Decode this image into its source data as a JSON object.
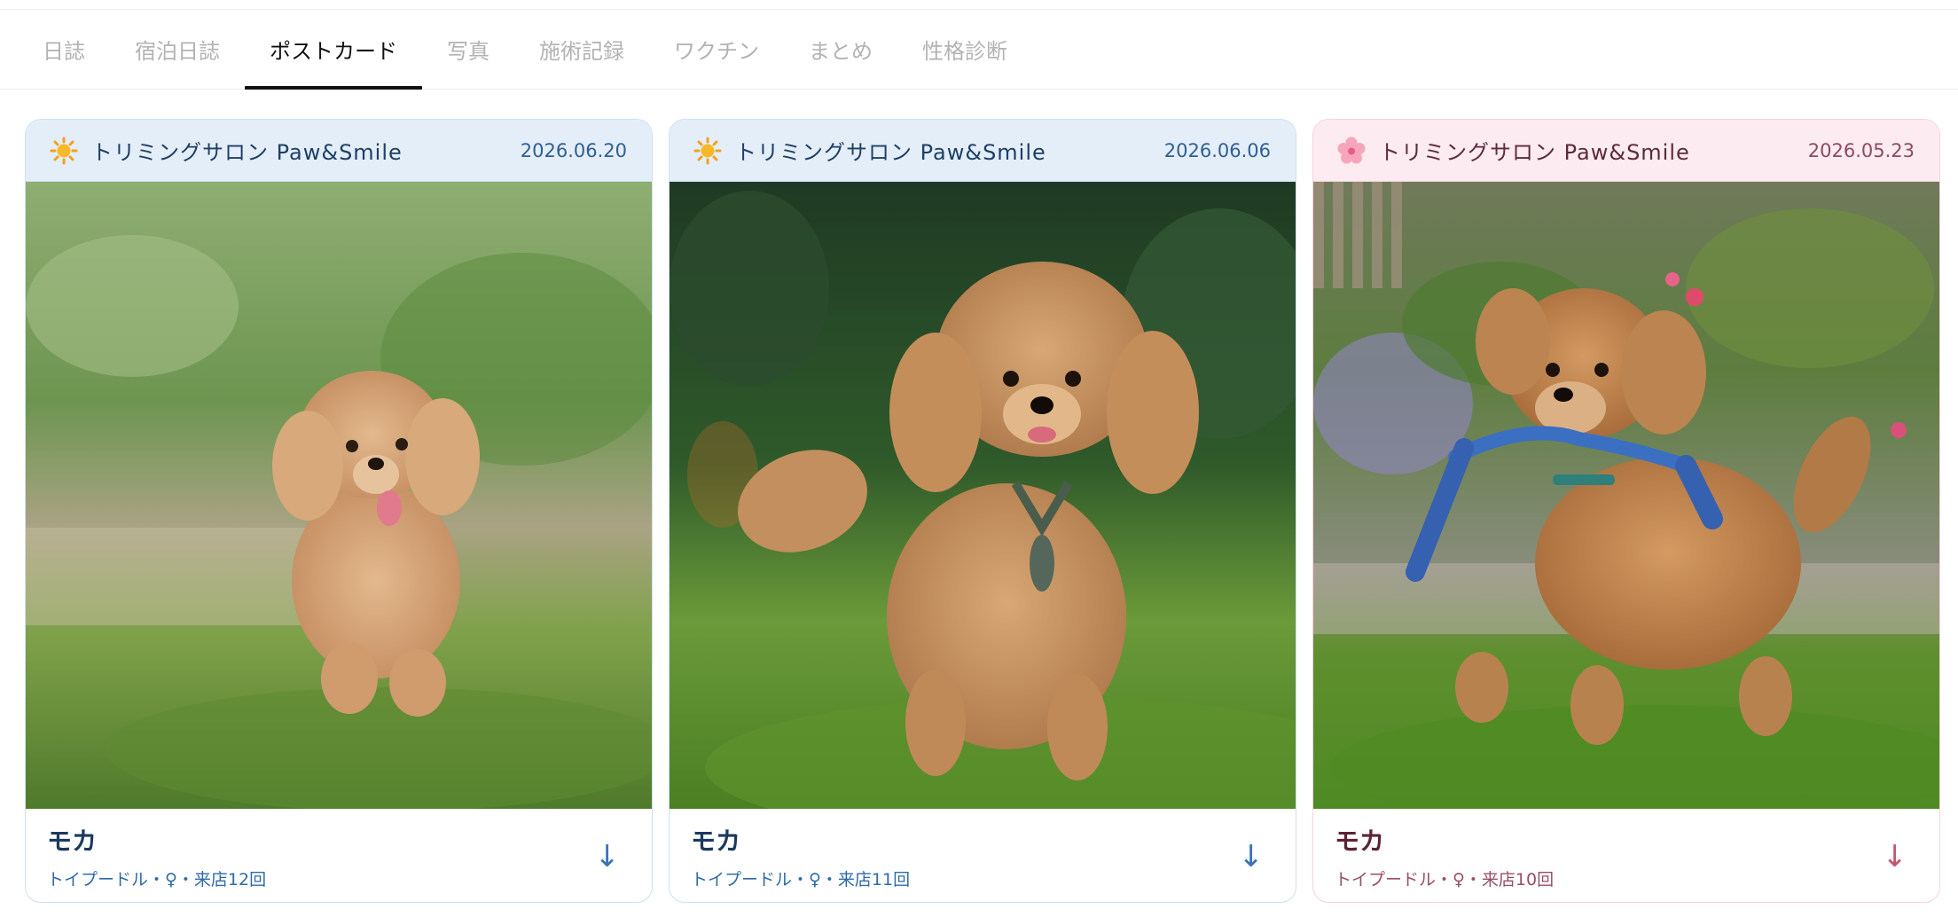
{
  "tabs": [
    {
      "label": "日誌",
      "active": false
    },
    {
      "label": "宿泊日誌",
      "active": false
    },
    {
      "label": "ポストカード",
      "active": true
    },
    {
      "label": "写真",
      "active": false
    },
    {
      "label": "施術記録",
      "active": false
    },
    {
      "label": "ワクチン",
      "active": false
    },
    {
      "label": "まとめ",
      "active": false
    },
    {
      "label": "性格診断",
      "active": false
    }
  ],
  "postcards": [
    {
      "theme": "blue",
      "icon": "sun-icon",
      "salon": "トリミングサロン Paw&Smile",
      "date": "2026.06.20",
      "pet_name": "モカ",
      "meta": "トイプードル・♀・来店12回",
      "download": "↓",
      "accent": "#2f5f95"
    },
    {
      "theme": "blue",
      "icon": "sun-icon",
      "salon": "トリミングサロン Paw&Smile",
      "date": "2026.06.06",
      "pet_name": "モカ",
      "meta": "トイプードル・♀・来店11回",
      "download": "↓",
      "accent": "#2f5f95"
    },
    {
      "theme": "pink",
      "icon": "cherry-blossom-icon",
      "salon": "トリミングサロン Paw&Smile",
      "date": "2026.05.23",
      "pet_name": "モカ",
      "meta": "トイプードル・♀・来店10回",
      "download": "↓",
      "accent": "#c2566f"
    }
  ]
}
